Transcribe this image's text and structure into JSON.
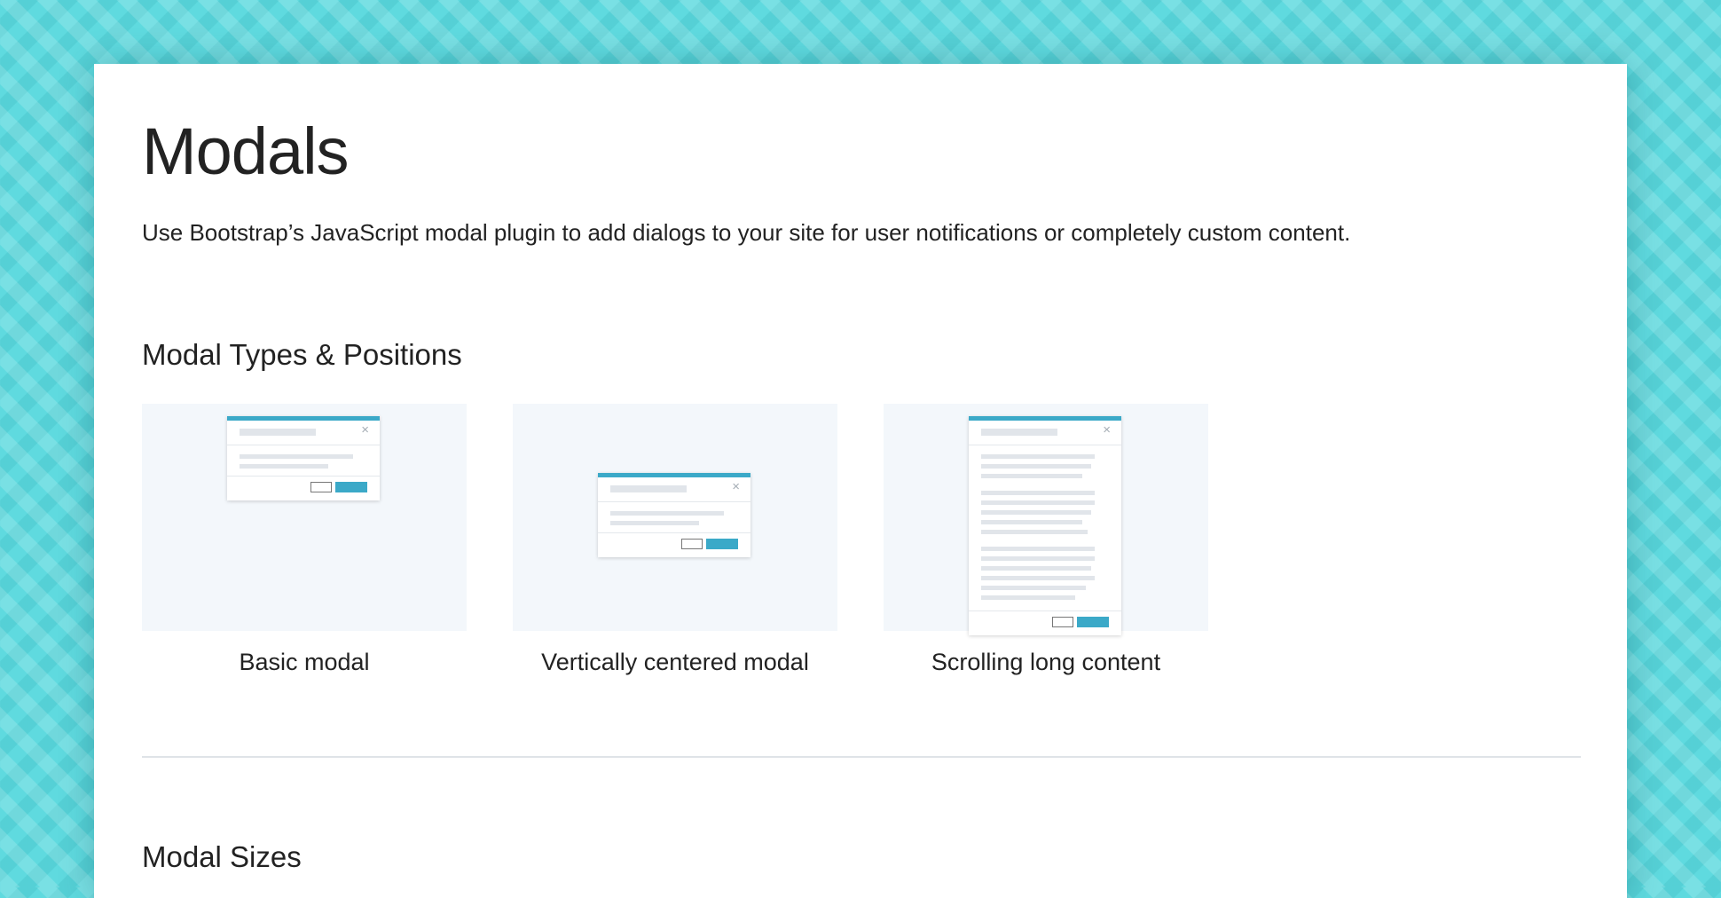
{
  "page": {
    "title": "Modals",
    "description": "Use Bootstrap’s JavaScript modal plugin to add dialogs to your site for user notifications or completely custom content."
  },
  "sections": [
    {
      "heading": "Modal Types & Positions"
    },
    {
      "heading": "Modal Sizes"
    }
  ],
  "tiles": [
    {
      "label": "Basic modal",
      "close_glyph": "×"
    },
    {
      "label": "Vertically centered modal",
      "close_glyph": "×"
    },
    {
      "label": "Scrolling long content",
      "close_glyph": "×"
    }
  ],
  "colors": {
    "accent": "#3ba9c8",
    "background": "#5fdadf",
    "thumb_bg": "#f3f7fb"
  },
  "icons": {
    "close": "close-icon"
  }
}
